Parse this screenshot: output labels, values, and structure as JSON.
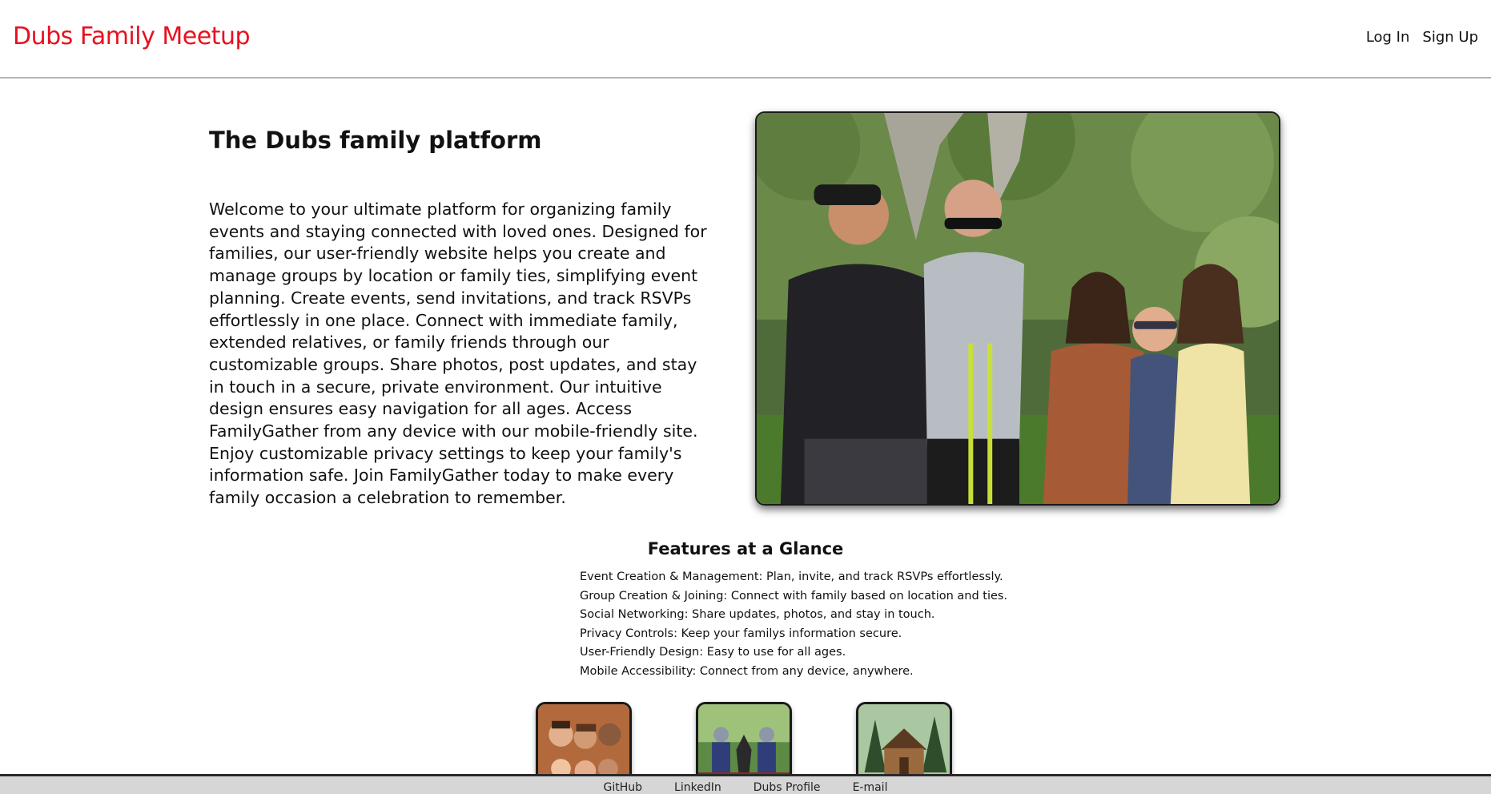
{
  "header": {
    "brand": "Dubs Family Meetup",
    "login_label": "Log In",
    "signup_label": "Sign Up"
  },
  "hero": {
    "title": "The Dubs family platform",
    "body": "Welcome to your ultimate platform for organizing family events and staying connected with loved ones. Designed for families, our user-friendly website helps you create and manage groups by location or family ties, simplifying event planning. Create events, send invitations, and track RSVPs effortlessly in one place. Connect with immediate family, extended relatives, or family friends through our customizable groups. Share photos, post updates, and stay in touch in a secure, private environment. Our intuitive design ensures easy navigation for all ages. Access FamilyGather from any device with our mobile-friendly site. Enjoy customizable privacy settings to keep your family's information safe. Join FamilyGather today to make every family occasion a celebration to remember."
  },
  "features": {
    "title": "Features at a Glance",
    "items": [
      "Event Creation & Management: Plan, invite, and track RSVPs effortlessly.",
      "Group Creation & Joining: Connect with family based on location and ties.",
      "Social Networking: Share updates, photos, and stay in touch.",
      "Privacy Controls: Keep your familys information secure.",
      "User-Friendly Design: Easy to use for all ages.",
      "Mobile Accessibility: Connect from any device, anywhere."
    ]
  },
  "footer": {
    "links": [
      "GitHub",
      "LinkedIn",
      "Dubs Profile",
      "E-mail"
    ]
  },
  "colors": {
    "brand": "#e8101f",
    "footer_bg": "#d6d6d6",
    "divider": "#b5b5b5"
  }
}
